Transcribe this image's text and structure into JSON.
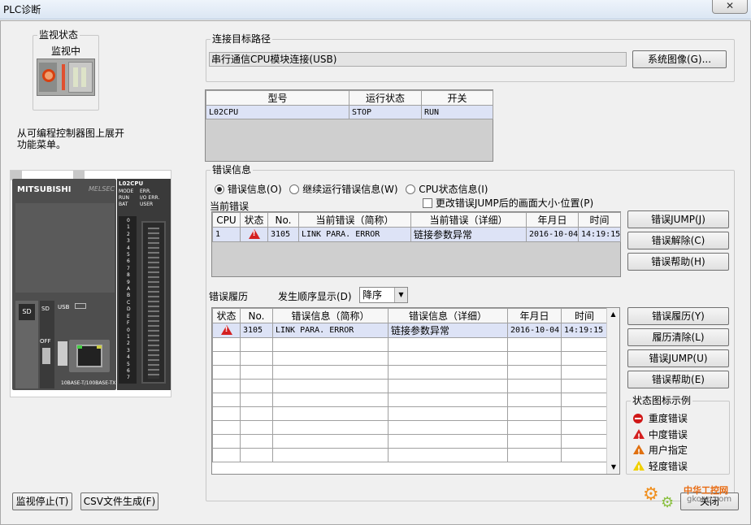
{
  "window": {
    "title": "PLC诊断",
    "close": "✕"
  },
  "monitor": {
    "group": "监视状态",
    "state": "监视中"
  },
  "hint": "从可编程控制器图上展开功能菜单。",
  "plc_image": {
    "brand": "MITSUBISHI",
    "brand_model": "MELSEC",
    "model": "L02CPU",
    "leds": [
      "MODE",
      "RUN",
      "BAT"
    ],
    "leds_right": [
      "ERR.",
      "I/O ERR.",
      "USER"
    ],
    "sd": "SD",
    "usb": "USB",
    "off": "OFF",
    "ether": "10BASE-T/100BASE-TX",
    "io_numbers": [
      "0",
      "1",
      "2",
      "3",
      "4",
      "5",
      "6",
      "7",
      "8",
      "9",
      "A",
      "B",
      "C",
      "D",
      "E",
      "F",
      "0",
      "1",
      "2",
      "3",
      "4",
      "5",
      "6",
      "7"
    ]
  },
  "connection": {
    "group": "连接目标路径",
    "value": "串行通信CPU模块连接(USB)",
    "system_image_btn": "系统图像(G)..."
  },
  "cpu_table": {
    "headers": [
      "型号",
      "运行状态",
      "开关"
    ],
    "row": [
      "L02CPU",
      "STOP",
      "RUN"
    ]
  },
  "error_info": {
    "group": "错误信息",
    "radios": [
      "错误信息(O)",
      "继续运行错误信息(W)",
      "CPU状态信息(I)"
    ],
    "checkbox": "更改错误JUMP后的画面大小·位置(P)",
    "current_label": "当前错误",
    "current_headers": [
      "CPU",
      "状态",
      "No.",
      "当前错误（简称）",
      "当前错误（详细）",
      "年月日",
      "时间"
    ],
    "current_row": [
      "1",
      "",
      "3105",
      "LINK PARA. ERROR",
      "链接参数异常",
      "2016-10-04",
      "14:19:15"
    ],
    "btn_jump": "错误JUMP(J)",
    "btn_clear": "错误解除(C)",
    "btn_help": "错误帮助(H)"
  },
  "history": {
    "label": "错误履历",
    "order_label": "发生顺序显示(D)",
    "order_value": "降序",
    "headers": [
      "状态",
      "No.",
      "错误信息（简称）",
      "错误信息（详细）",
      "年月日",
      "时间"
    ],
    "row": [
      "",
      "3105",
      "LINK PARA. ERROR",
      "链接参数异常",
      "2016-10-04",
      "14:19:15"
    ],
    "btn_history": "错误履历(Y)",
    "btn_clear": "履历清除(L)",
    "btn_jump": "错误JUMP(U)",
    "btn_help": "错误帮助(E)"
  },
  "legend": {
    "group": "状态图标示例",
    "items": [
      {
        "label": "重度错误",
        "icon": "major-error-icon",
        "color": "#d01818"
      },
      {
        "label": "中度错误",
        "icon": "moderate-error-icon",
        "color": "#d01818"
      },
      {
        "label": "用户指定",
        "icon": "user-specified-icon",
        "color": "#e07010"
      },
      {
        "label": "轻度错误",
        "icon": "minor-error-icon",
        "color": "#f0d000"
      }
    ]
  },
  "footer": {
    "stop_btn": "监视停止(T)",
    "csv_btn": "CSV文件生成(F)",
    "close_btn": "关闭"
  },
  "watermark": {
    "text": "中华工控网",
    "url": "gkong.com"
  }
}
